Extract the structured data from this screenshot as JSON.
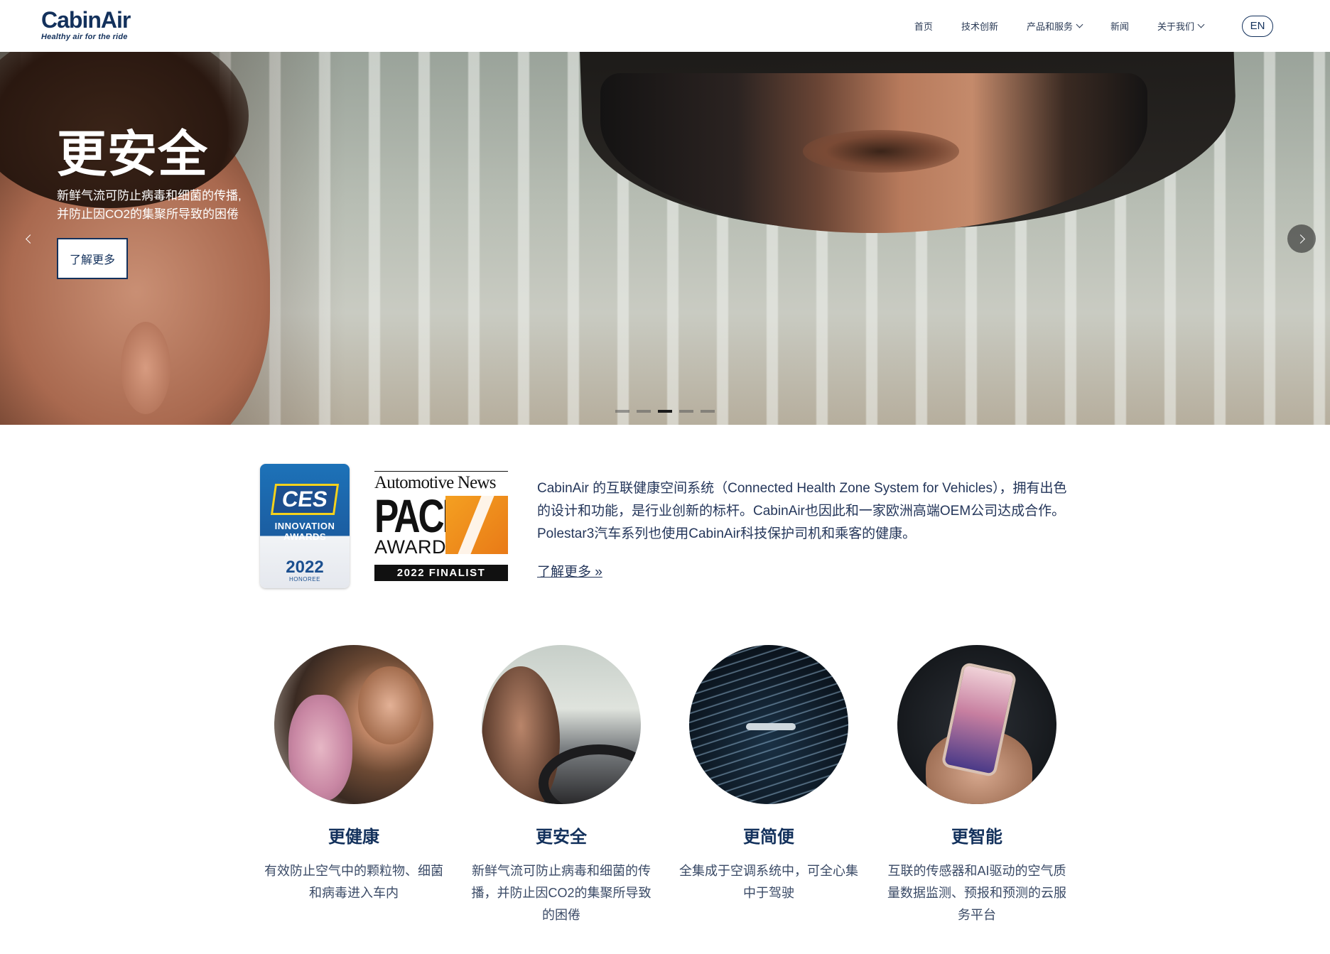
{
  "brand": {
    "logo_text": "CabinAir",
    "tagline": "Healthy air for the ride",
    "accent_color": "#13315c"
  },
  "nav": {
    "items": [
      {
        "label": "首页",
        "has_dropdown": false
      },
      {
        "label": "技术创新",
        "has_dropdown": false
      },
      {
        "label": "产品和服务",
        "has_dropdown": true
      },
      {
        "label": "新闻",
        "has_dropdown": false
      },
      {
        "label": "关于我们",
        "has_dropdown": true
      }
    ],
    "language_button": "EN"
  },
  "hero": {
    "title": "更安全",
    "subtitle_line1": "新鲜气流可防止病毒和细菌的传播,",
    "subtitle_line2": "并防止因CO2的集聚所导致的困倦",
    "button_label": "了解更多",
    "slide_count": 5,
    "active_slide": 3,
    "prev_icon": "chevron-left-icon",
    "next_icon": "chevron-right-icon"
  },
  "awards": {
    "ces": {
      "logo": "CES",
      "line1": "INNOVATION",
      "line2": "AWARDS",
      "year": "2022",
      "honoree": "HONOREE"
    },
    "pace": {
      "publisher": "Automotive News",
      "name": "PACE",
      "award": "AWARD",
      "finalist": "2022 FINALIST"
    },
    "description": "CabinAir 的互联健康空间系统（Connected Health Zone System for Vehicles），拥有出色的设计和功能，是行业创新的标杆。CabinAir也因此和一家欧洲高端OEM公司达成合作。Polestar3汽车系列也使用CabinAir科技保护司机和乘客的健康。",
    "link_label": "了解更多 »"
  },
  "features": [
    {
      "title": "更健康",
      "text": "有效防止空气中的颗粒物、细菌和病毒进入车内"
    },
    {
      "title": "更安全",
      "text": "新鲜气流可防止病毒和细菌的传播，并防止因CO2的集聚所导致的困倦"
    },
    {
      "title": "更简便",
      "text": "全集成于空调系统中，可全心集中于驾驶"
    },
    {
      "title": "更智能",
      "text": "互联的传感器和AI驱动的空气质量数据监测、预报和预测的云服务平台"
    }
  ]
}
